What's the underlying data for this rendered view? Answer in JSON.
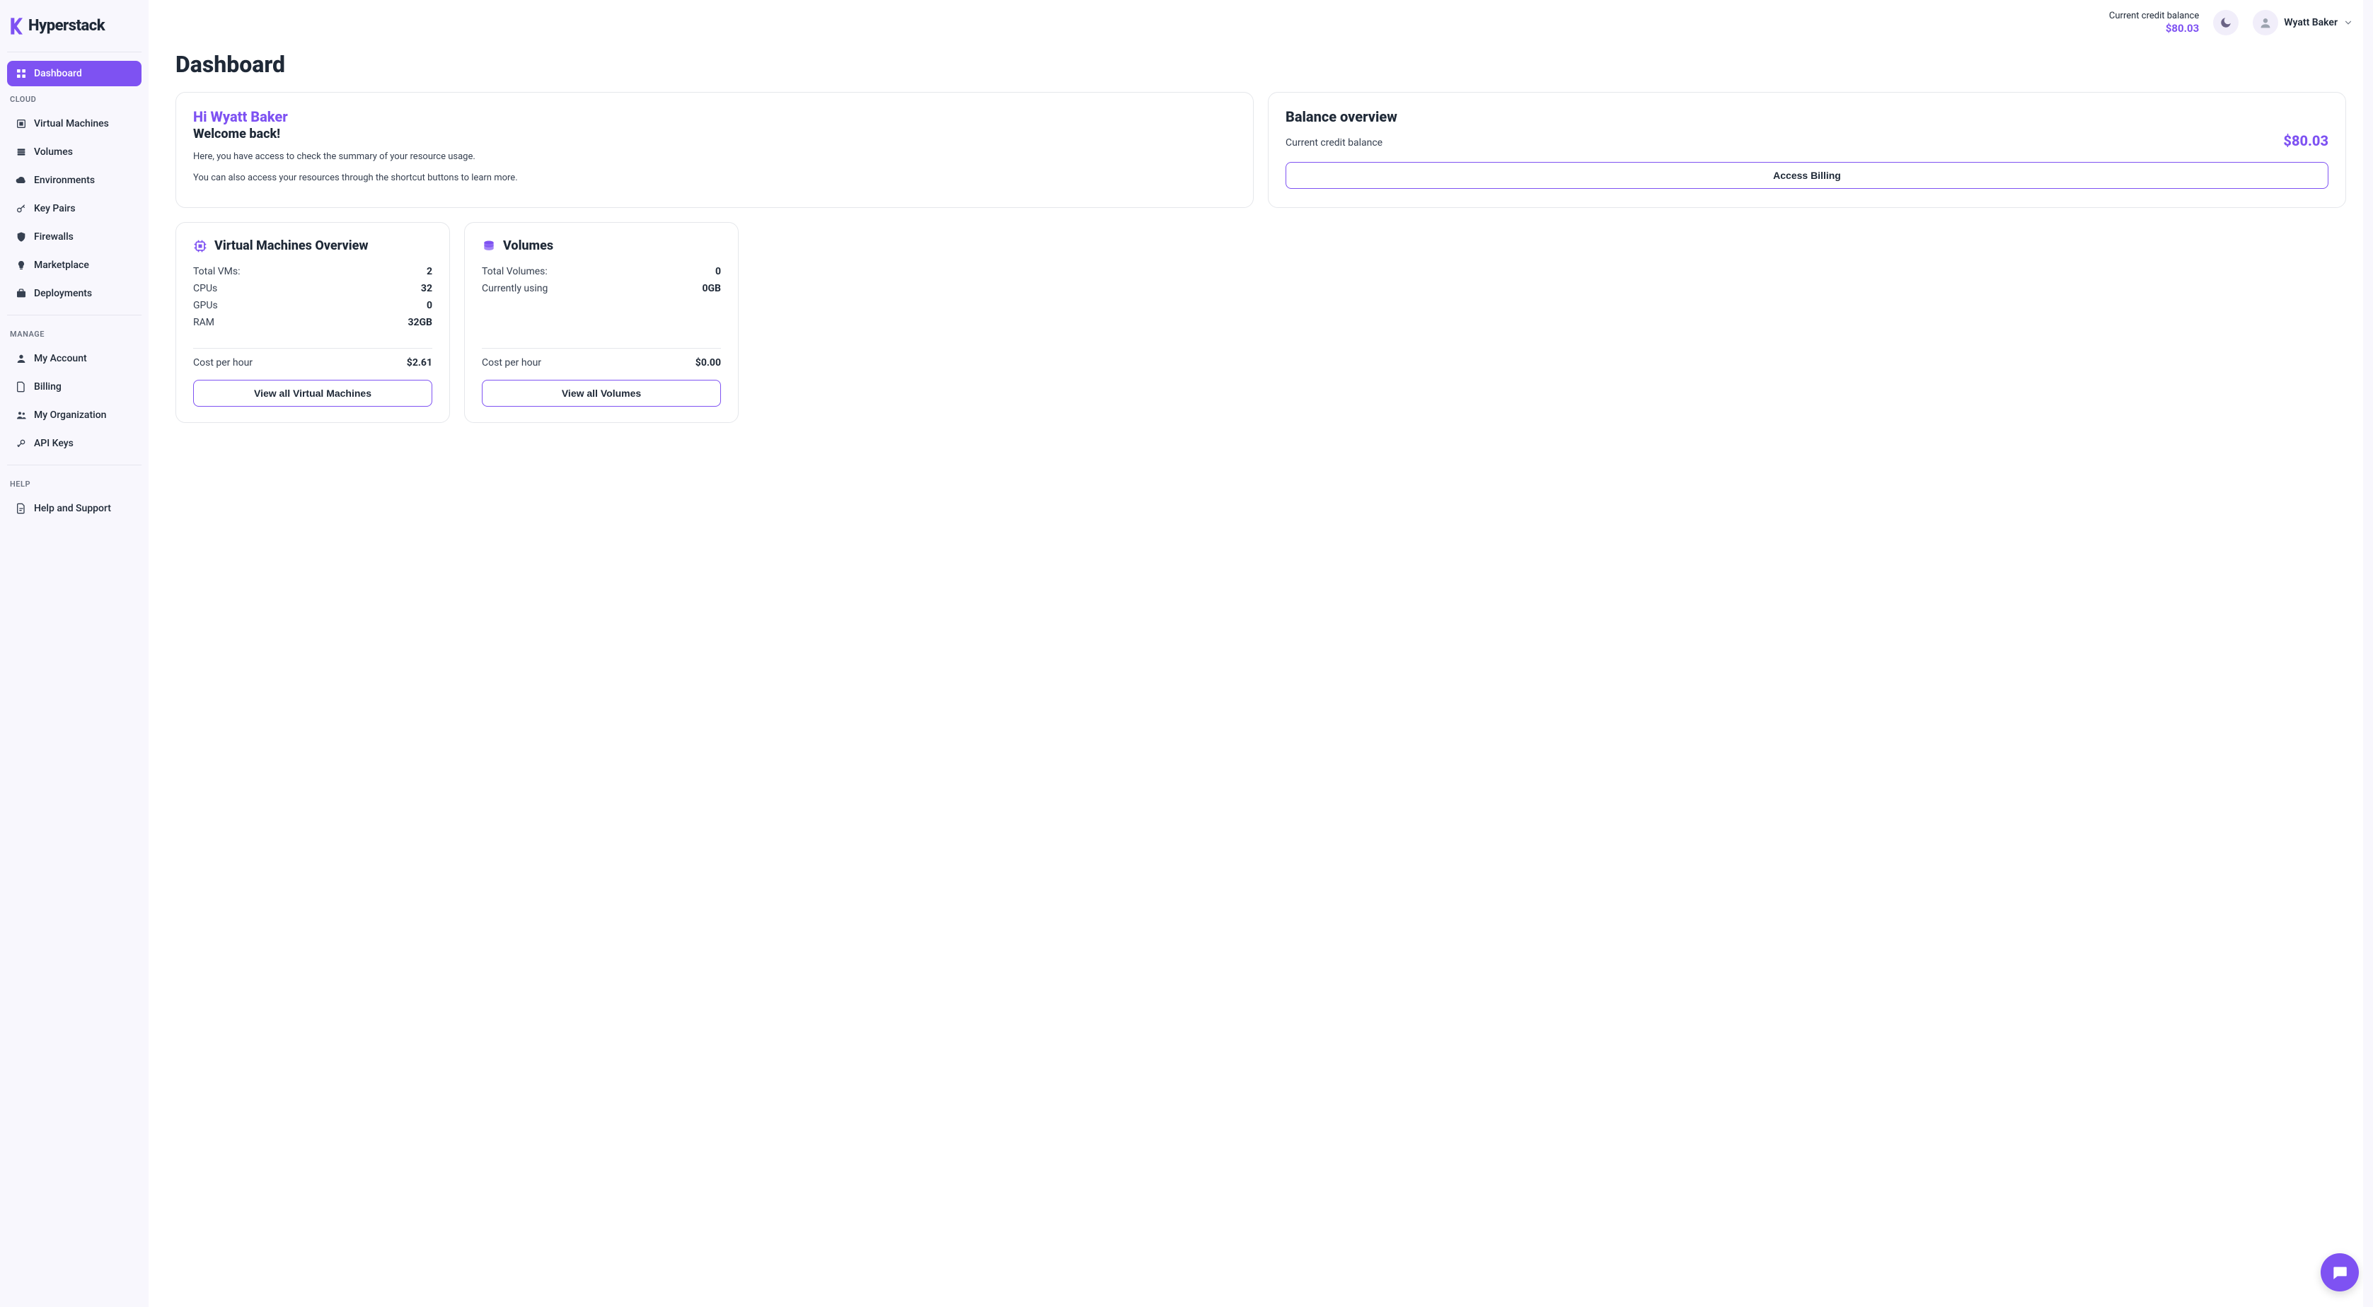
{
  "brand": "Hyperstack",
  "sidebar": {
    "main_items": [
      {
        "label": "Dashboard",
        "icon": "dashboard-icon",
        "active": true
      }
    ],
    "sections": [
      {
        "label": "CLOUD",
        "items": [
          {
            "label": "Virtual Machines",
            "icon": "vm-icon"
          },
          {
            "label": "Volumes",
            "icon": "volumes-icon"
          },
          {
            "label": "Environments",
            "icon": "cloud-icon"
          },
          {
            "label": "Key Pairs",
            "icon": "key-icon"
          },
          {
            "label": "Firewalls",
            "icon": "shield-icon"
          },
          {
            "label": "Marketplace",
            "icon": "bulb-icon"
          },
          {
            "label": "Deployments",
            "icon": "briefcase-icon"
          }
        ]
      },
      {
        "label": "MANAGE",
        "items": [
          {
            "label": "My Account",
            "icon": "user-icon"
          },
          {
            "label": "Billing",
            "icon": "file-icon"
          },
          {
            "label": "My Organization",
            "icon": "users-icon"
          },
          {
            "label": "API Keys",
            "icon": "key2-icon"
          }
        ]
      },
      {
        "label": "HELP",
        "items": [
          {
            "label": "Help and Support",
            "icon": "doc-icon"
          }
        ]
      }
    ]
  },
  "topbar": {
    "balance_label": "Current credit balance",
    "balance_amount": "$80.03",
    "user_name": "Wyatt Baker"
  },
  "page_title": "Dashboard",
  "welcome": {
    "greet": "Hi Wyatt Baker",
    "back": "Welcome back!",
    "line1": "Here, you have access to check the summary of your resource usage.",
    "line2": "You can also access your resources through the shortcut buttons to learn more."
  },
  "balance_card": {
    "title": "Balance overview",
    "label": "Current credit balance",
    "value": "$80.03",
    "button": "Access Billing"
  },
  "vm_card": {
    "title": "Virtual Machines Overview",
    "stats": [
      {
        "label": "Total VMs:",
        "value": "2"
      },
      {
        "label": "CPUs",
        "value": "32"
      },
      {
        "label": "GPUs",
        "value": "0"
      },
      {
        "label": "RAM",
        "value": "32GB"
      }
    ],
    "cost_label": "Cost per hour",
    "cost_value": "$2.61",
    "button": "View all Virtual Machines"
  },
  "vol_card": {
    "title": "Volumes",
    "stats": [
      {
        "label": "Total Volumes:",
        "value": "0"
      },
      {
        "label": "Currently using",
        "value": "0GB"
      }
    ],
    "cost_label": "Cost per hour",
    "cost_value": "$0.00",
    "button": "View all Volumes"
  }
}
